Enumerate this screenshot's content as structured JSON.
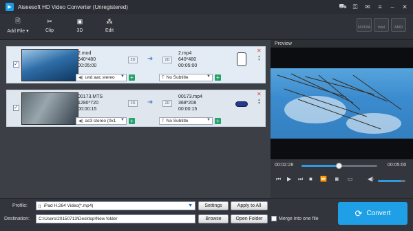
{
  "app": {
    "title": "Aiseesoft HD Video Converter (Unregistered)"
  },
  "toolbar": {
    "add_file": "Add File",
    "clip": "Clip",
    "three_d": "3D",
    "edit": "Edit",
    "accel": [
      "NVIDIA",
      "Intel",
      "AMD"
    ]
  },
  "files": [
    {
      "src_name": "2.mod",
      "src_res": "640*480",
      "src_dur": "00:05:00",
      "out_name": "2.mp4",
      "out_res": "640*480",
      "out_dur": "00:05:00",
      "audio": "und aac stereo",
      "subtitle": "No Subtitle",
      "device_icon": "iphone-icon",
      "checked": true
    },
    {
      "src_name": "00173.MTS",
      "src_res": "1280*720",
      "src_dur": "00:00:15",
      "out_name": "00173.mp4",
      "out_res": "368*208",
      "out_dur": "00:00:15",
      "audio": "ac3 stereo (0x1",
      "subtitle": "No Subtitle",
      "device_icon": "psp-icon",
      "checked": true
    }
  ],
  "badge_2d": "2D",
  "subtitle_lead": "T",
  "preview": {
    "title": "Preview",
    "time_current": "00:02:28",
    "time_total": "00:05:00",
    "progress": 0.49,
    "volume": 0.85
  },
  "bottom": {
    "profile_label": "Profile:",
    "profile_value": "iPad H.264 Video(*.mp4)",
    "settings": "Settings",
    "apply_all": "Apply to All",
    "dest_label": "Destination:",
    "dest_value": "C:\\Users\\20150713\\Desktop\\New folder",
    "browse": "Browse",
    "open_folder": "Open Folder",
    "merge": "Merge into one file",
    "convert": "Convert"
  },
  "colors": {
    "accent": "#1fa0e6",
    "add_green": "#25a36a",
    "remove_red": "#e04141"
  }
}
